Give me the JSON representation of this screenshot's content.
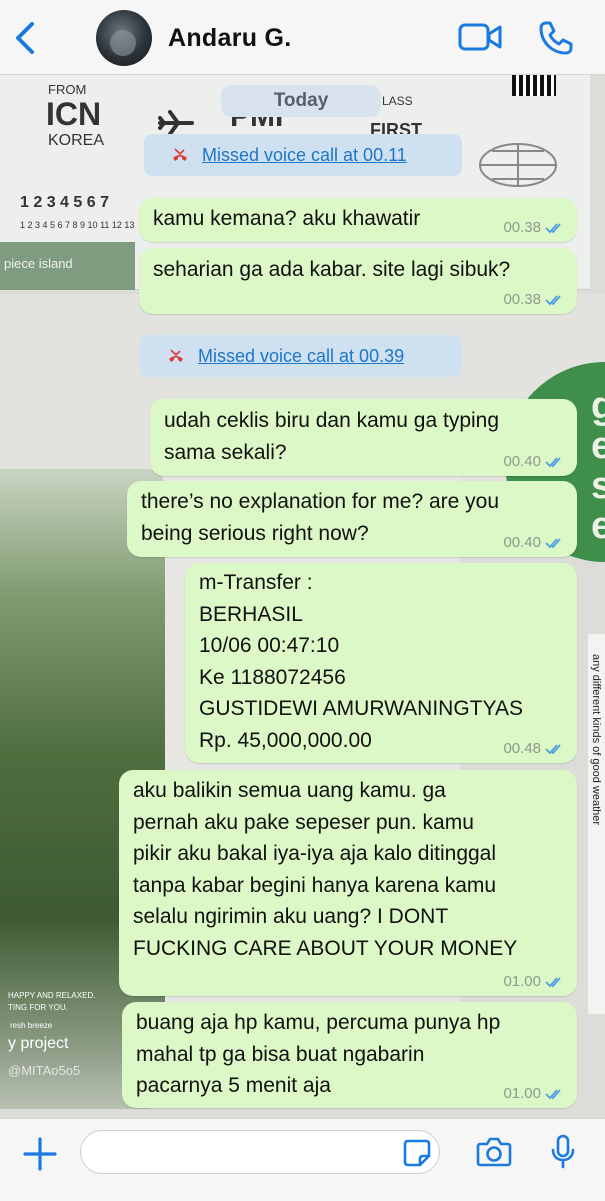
{
  "header": {
    "contact_name": "Andaru G."
  },
  "wallpaper": {
    "ticket_from_label": "FROM",
    "ticket_from_code": "ICN",
    "ticket_from_country": "KOREA",
    "ticket_to_code": "PMI",
    "ticket_class_label": "LASS",
    "ticket_class": "FIRST",
    "ticket_digits_large": "1 2 3 4 5 6 7",
    "ticket_digits_small": "1 2 3 4 5 6 7 8 9 10 11 12 13",
    "ticket_island": "piece island",
    "forest_caption_1": "HAPPY AND RELAXED.",
    "forest_caption_2": "TING FOR YOU.",
    "forest_caption_3": "resh breeze",
    "forest_caption_4": "y project",
    "forest_handle": "@MITAo5o5",
    "right_card_text": "any different kinds of good weather",
    "green_circle_text": "g\nec\nsh\nee"
  },
  "date_pill": "Today",
  "calls": [
    {
      "label": "Missed voice call at 00.11"
    },
    {
      "label": "Missed voice call at 00.39"
    }
  ],
  "messages": [
    {
      "text": "kamu kemana? aku khawatir",
      "time": "00.38"
    },
    {
      "text": "seharian ga ada kabar. site lagi sibuk?",
      "time": "00.38"
    },
    {
      "text": "udah ceklis biru dan kamu ga typing\nsama sekali?",
      "time": "00.40"
    },
    {
      "text": "there’s no explanation for me? are you\nbeing serious right now?",
      "time": "00.40"
    },
    {
      "text": "m-Transfer :\nBERHASIL\n10/06 00:47:10\nKe 1188072456\nGUSTIDEWI AMURWANINGTYAS\nRp. 45,000,000.00",
      "time": "00.48"
    },
    {
      "text": "aku balikin semua uang kamu. ga\npernah aku pake sepeser pun. kamu\npikir aku bakal iya-iya aja kalo ditinggal\ntanpa kabar begini hanya karena kamu\nselalu ngirimin aku uang? I DONT\nFUCKING CARE ABOUT YOUR MONEY",
      "time": "01.00"
    },
    {
      "text": "buang aja hp kamu, percuma punya hp\nmahal tp ga bisa buat ngabarin\npacarnya 5 menit aja",
      "time": "01.00"
    }
  ],
  "colors": {
    "bubble": "#dcf8c6",
    "accent": "#1d76c8",
    "read_tick": "#4fa3e0"
  }
}
